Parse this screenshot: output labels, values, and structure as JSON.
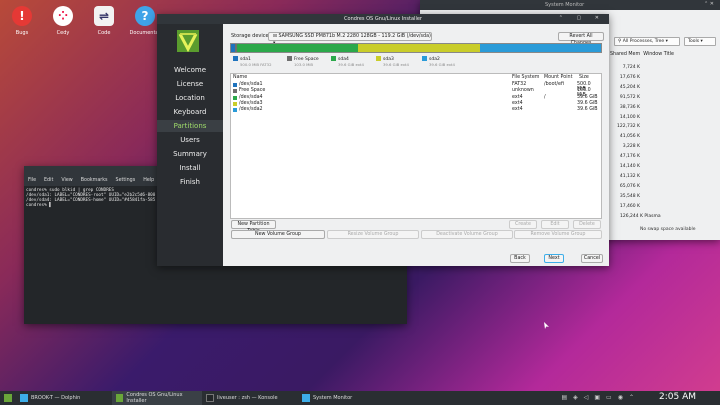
{
  "desktop": {
    "icons": [
      {
        "name": "Bugs",
        "color": "#e53935",
        "glyph": "!"
      },
      {
        "name": "Cedy",
        "color": "#ffffff",
        "glyph": "⁘"
      },
      {
        "name": "Code",
        "color": "#f2f2f2",
        "glyph": "⇌"
      },
      {
        "name": "Documentat",
        "color": "#3fa3e8",
        "glyph": "?"
      }
    ]
  },
  "system_monitor": {
    "title": "System Monitor",
    "filter": "All Processes, Tree",
    "tools": "Tools",
    "col_memory": "Shared Mem",
    "col_window": "Window Title",
    "rows": [
      "7,724 K",
      "17,676 K",
      "45,204 K",
      "91,572 K",
      "38,736 K",
      "14,100 K",
      "122,732 K",
      "41,056 K",
      "3,228 K",
      "47,176 K",
      "14,140 K",
      "41,132 K",
      "65,076 K",
      "35,548 K",
      "17,460 K",
      "126,244 K Plasma"
    ],
    "footer": "No swap space available"
  },
  "terminal": {
    "menu": [
      "File",
      "Edit",
      "View",
      "Bookmarks",
      "Settings",
      "Help"
    ],
    "lines": [
      "condres% sudo blkid | grep CONDRES",
      "/dev/sda1: LABEL=\"CONDRES-root\" UUID=\"e2b2c5d6-800",
      "/dev/sda4: LABEL=\"CONDRES-home\" UUID=\"#45841fa-585",
      "condres% ▌"
    ]
  },
  "installer": {
    "title": "Condres OS Gnu/Linux Installer",
    "nav": [
      "Welcome",
      "License",
      "Location",
      "Keyboard",
      "Partitions",
      "Users",
      "Summary",
      "Install",
      "Finish"
    ],
    "active_nav": "Partitions",
    "storage_label": "Storage device:",
    "storage_value": "SAMSUNG SSD PM871b M.2 2280 128GB - 119.2 GiB (/dev/sda)",
    "revert": "Revert All Changes",
    "legend": [
      {
        "name": "sda1",
        "sub": "500.0 MiB  FAT32",
        "color": "#1e73be"
      },
      {
        "name": "Free Space",
        "sub": "103.0 MiB",
        "color": "#6e6e6e"
      },
      {
        "name": "sda4",
        "sub": "39.6 GiB  ext4",
        "color": "#2ba84a"
      },
      {
        "name": "sda3",
        "sub": "39.6 GiB  ext4",
        "color": "#c9cd2a"
      },
      {
        "name": "sda2",
        "sub": "39.6 GiB  ext4",
        "color": "#2a9bd8"
      }
    ],
    "columns": [
      "Name",
      "File System",
      "Mount Point",
      "Size"
    ],
    "rows": [
      {
        "name": "/dev/sda1",
        "fs": "FAT32",
        "mount": "/boot/efi",
        "size": "500.0 MiB",
        "color": "#1e73be"
      },
      {
        "name": "Free Space",
        "fs": "unknown",
        "mount": "",
        "size": "103.0 MiB",
        "color": "#6e6e6e"
      },
      {
        "name": "/dev/sda4",
        "fs": "ext4",
        "mount": "/",
        "size": "39.6 GiB",
        "color": "#2ba84a"
      },
      {
        "name": "/dev/sda3",
        "fs": "ext4",
        "mount": "",
        "size": "39.6 GiB",
        "color": "#c9cd2a"
      },
      {
        "name": "/dev/sda2",
        "fs": "ext4",
        "mount": "",
        "size": "39.6 GiB",
        "color": "#2a9bd8"
      }
    ],
    "buttons": {
      "new_table": "New Partition Table",
      "create": "Create",
      "edit": "Edit",
      "delete": "Delete",
      "new_vg": "New Volume Group",
      "resize_vg": "Resize Volume Group",
      "deactivate_vg": "Deactivate Volume Group",
      "remove_vg": "Remove Volume Group",
      "back": "Back",
      "next": "Next",
      "cancel": "Cancel"
    }
  },
  "taskbar": {
    "tasks": [
      "BROOK-T — Dolphin",
      "Condres OS Gnu/Linux Installer",
      "liveuser : zsh — Konsole",
      "System Monitor"
    ],
    "active": "Condres OS Gnu/Linux Installer",
    "clock": "2:05 AM"
  }
}
